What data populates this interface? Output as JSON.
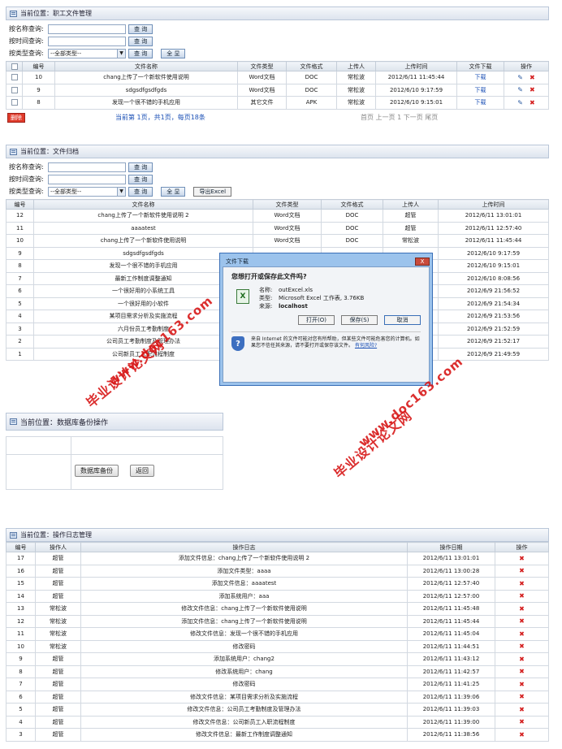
{
  "s1": {
    "location": "当前位置：职工文件管理",
    "filters": [
      {
        "label": "按名称查询:",
        "button": "查 询",
        "button2": ""
      },
      {
        "label": "按时间查询:",
        "button": "查 询",
        "button2": ""
      },
      {
        "label": "按类型查询:",
        "select": "--全部类型--",
        "button": "查 询",
        "button2": "全 显"
      }
    ],
    "headers": [
      "",
      "编号",
      "文件名称",
      "文件类型",
      "文件格式",
      "上传人",
      "上传时间",
      "文件下载",
      "操作"
    ],
    "rows": [
      [
        "10",
        "chang上传了一个新软件使用说明",
        "Word文档",
        "DOC",
        "常松波",
        "2012/6/11 11:45:44",
        "下载"
      ],
      [
        "9",
        "sdgsdfgsdfgds",
        "Word文档",
        "DOC",
        "常松波",
        "2012/6/10 9:17:59",
        "下载"
      ],
      [
        "8",
        "发现一个很不错的手机应用",
        "其它文件",
        "APK",
        "常松波",
        "2012/6/10 9:15:01",
        "下载"
      ]
    ],
    "delete_button": "删除",
    "pagination_info": "当前第 1页，共1页，每页18条",
    "pagination_nav": "首页 上一页 1 下一页 尾页"
  },
  "s2": {
    "location": "当前位置：文件归档",
    "filters": [
      {
        "label": "按名称查询:",
        "button": "查 询"
      },
      {
        "label": "按时间查询:",
        "button": "查 询"
      },
      {
        "label": "按类型查询:",
        "select": "--全部类型--",
        "button": "查 询",
        "button2": "全 显",
        "button3": "导出Excel"
      }
    ],
    "headers": [
      "编号",
      "文件名称",
      "文件类型",
      "文件格式",
      "上传人",
      "上传时间"
    ],
    "rows": [
      [
        "12",
        "chang上传了一个新软件使用说明 2",
        "Word文档",
        "DOC",
        "超管",
        "2012/6/11 13:01:01"
      ],
      [
        "11",
        "aaaatest",
        "Word文档",
        "DOC",
        "超管",
        "2012/6/11 12:57:40"
      ],
      [
        "10",
        "chang上传了一个新软件使用说明",
        "Word文档",
        "DOC",
        "常松波",
        "2012/6/11 11:45:44"
      ],
      [
        "9",
        "sdgsdfgsdfgds",
        "",
        "",
        "",
        "2012/6/10 9:17:59"
      ],
      [
        "8",
        "发现一个很不错的手机应用",
        "",
        "",
        "",
        "2012/6/10 9:15:01"
      ],
      [
        "7",
        "最新工作制度调整通知",
        "",
        "",
        "",
        "2012/6/10 8:08:56"
      ],
      [
        "6",
        "一个很好用的小系统工具",
        "",
        "",
        "",
        "2012/6/9 21:56:52"
      ],
      [
        "5",
        "一个很好用的小软件",
        "",
        "",
        "",
        "2012/6/9 21:54:34"
      ],
      [
        "4",
        "某项目需求分析及实施流程",
        "",
        "",
        "",
        "2012/6/9 21:53:56"
      ],
      [
        "3",
        "六月份员工考勤制度",
        "",
        "",
        "",
        "2012/6/9 21:52:59"
      ],
      [
        "2",
        "公司员工考勤制度及管理办法",
        "",
        "",
        "",
        "2012/6/9 21:52:17"
      ],
      [
        "1",
        "公司新员工入职流程制度",
        "",
        "",
        "",
        "2012/6/9 21:49:59"
      ]
    ]
  },
  "dialog": {
    "title": "文件下载",
    "close": "X",
    "question": "您想打开或保存此文件吗?",
    "name_label": "名称:",
    "name": "outExcel.xls",
    "type_label": "类型:",
    "type": "Microsoft Excel 工作表, 3.76KB",
    "from_label": "来源:",
    "from": "localhost",
    "open": "打开(O)",
    "save": "保存(S)",
    "cancel": "取消",
    "warning": "来自 Internet 的文件可能对您有所帮助，但某些文件可能危害您的计算机。如果您不信任其来源，请不要打开或保存该文件。",
    "risk_link": "有何风险?"
  },
  "s3": {
    "location": "当前位置：数据库备份操作",
    "backup": "数据库备份",
    "back": "返回"
  },
  "s4": {
    "location": "当前位置：操作日志管理",
    "headers": [
      "编号",
      "操作人",
      "操作日志",
      "操作日期",
      "操作"
    ],
    "rows": [
      [
        "17",
        "超管",
        "添加文件信息：chang上传了一个新软件使用说明 2",
        "2012/6/11 13:01:01"
      ],
      [
        "16",
        "超管",
        "添加文件类型：aaaa",
        "2012/6/11 13:00:28"
      ],
      [
        "15",
        "超管",
        "添加文件信息：aaaatest",
        "2012/6/11 12:57:40"
      ],
      [
        "14",
        "超管",
        "添加系统用户：aaa",
        "2012/6/11 12:57:00"
      ],
      [
        "13",
        "常松波",
        "修改文件信息：chang上传了一个新软件使用说明",
        "2012/6/11 11:45:48"
      ],
      [
        "12",
        "常松波",
        "添加文件信息：chang上传了一个新软件使用说明",
        "2012/6/11 11:45:44"
      ],
      [
        "11",
        "常松波",
        "修改文件信息：发现一个很不错的手机应用",
        "2012/6/11 11:45:04"
      ],
      [
        "10",
        "常松波",
        "修改密码",
        "2012/6/11 11:44:51"
      ],
      [
        "9",
        "超管",
        "添加系统用户：chang2",
        "2012/6/11 11:43:12"
      ],
      [
        "8",
        "超管",
        "修改系统用户：chang",
        "2012/6/11 11:42:57"
      ],
      [
        "7",
        "超管",
        "修改密码",
        "2012/6/11 11:41:25"
      ],
      [
        "6",
        "超管",
        "修改文件信息：某项目需求分析及实施流程",
        "2012/6/11 11:39:06"
      ],
      [
        "5",
        "超管",
        "修改文件信息：公司员工考勤制度及管理办法",
        "2012/6/11 11:39:03"
      ],
      [
        "4",
        "超管",
        "修改文件信息：公司新员工入职流程制度",
        "2012/6/11 11:39:00"
      ],
      [
        "3",
        "超管",
        "修改文件信息：最新工作制度调整通知",
        "2012/6/11 11:38:56"
      ]
    ]
  },
  "watermarks": [
    "毕业设计论文网",
    "www.doc163.com",
    "毕业设计论文网",
    "www.doc163.com"
  ],
  "colors": {
    "link": "#1a4fb5",
    "delete": "#d42020",
    "watermark": "#d81818"
  }
}
